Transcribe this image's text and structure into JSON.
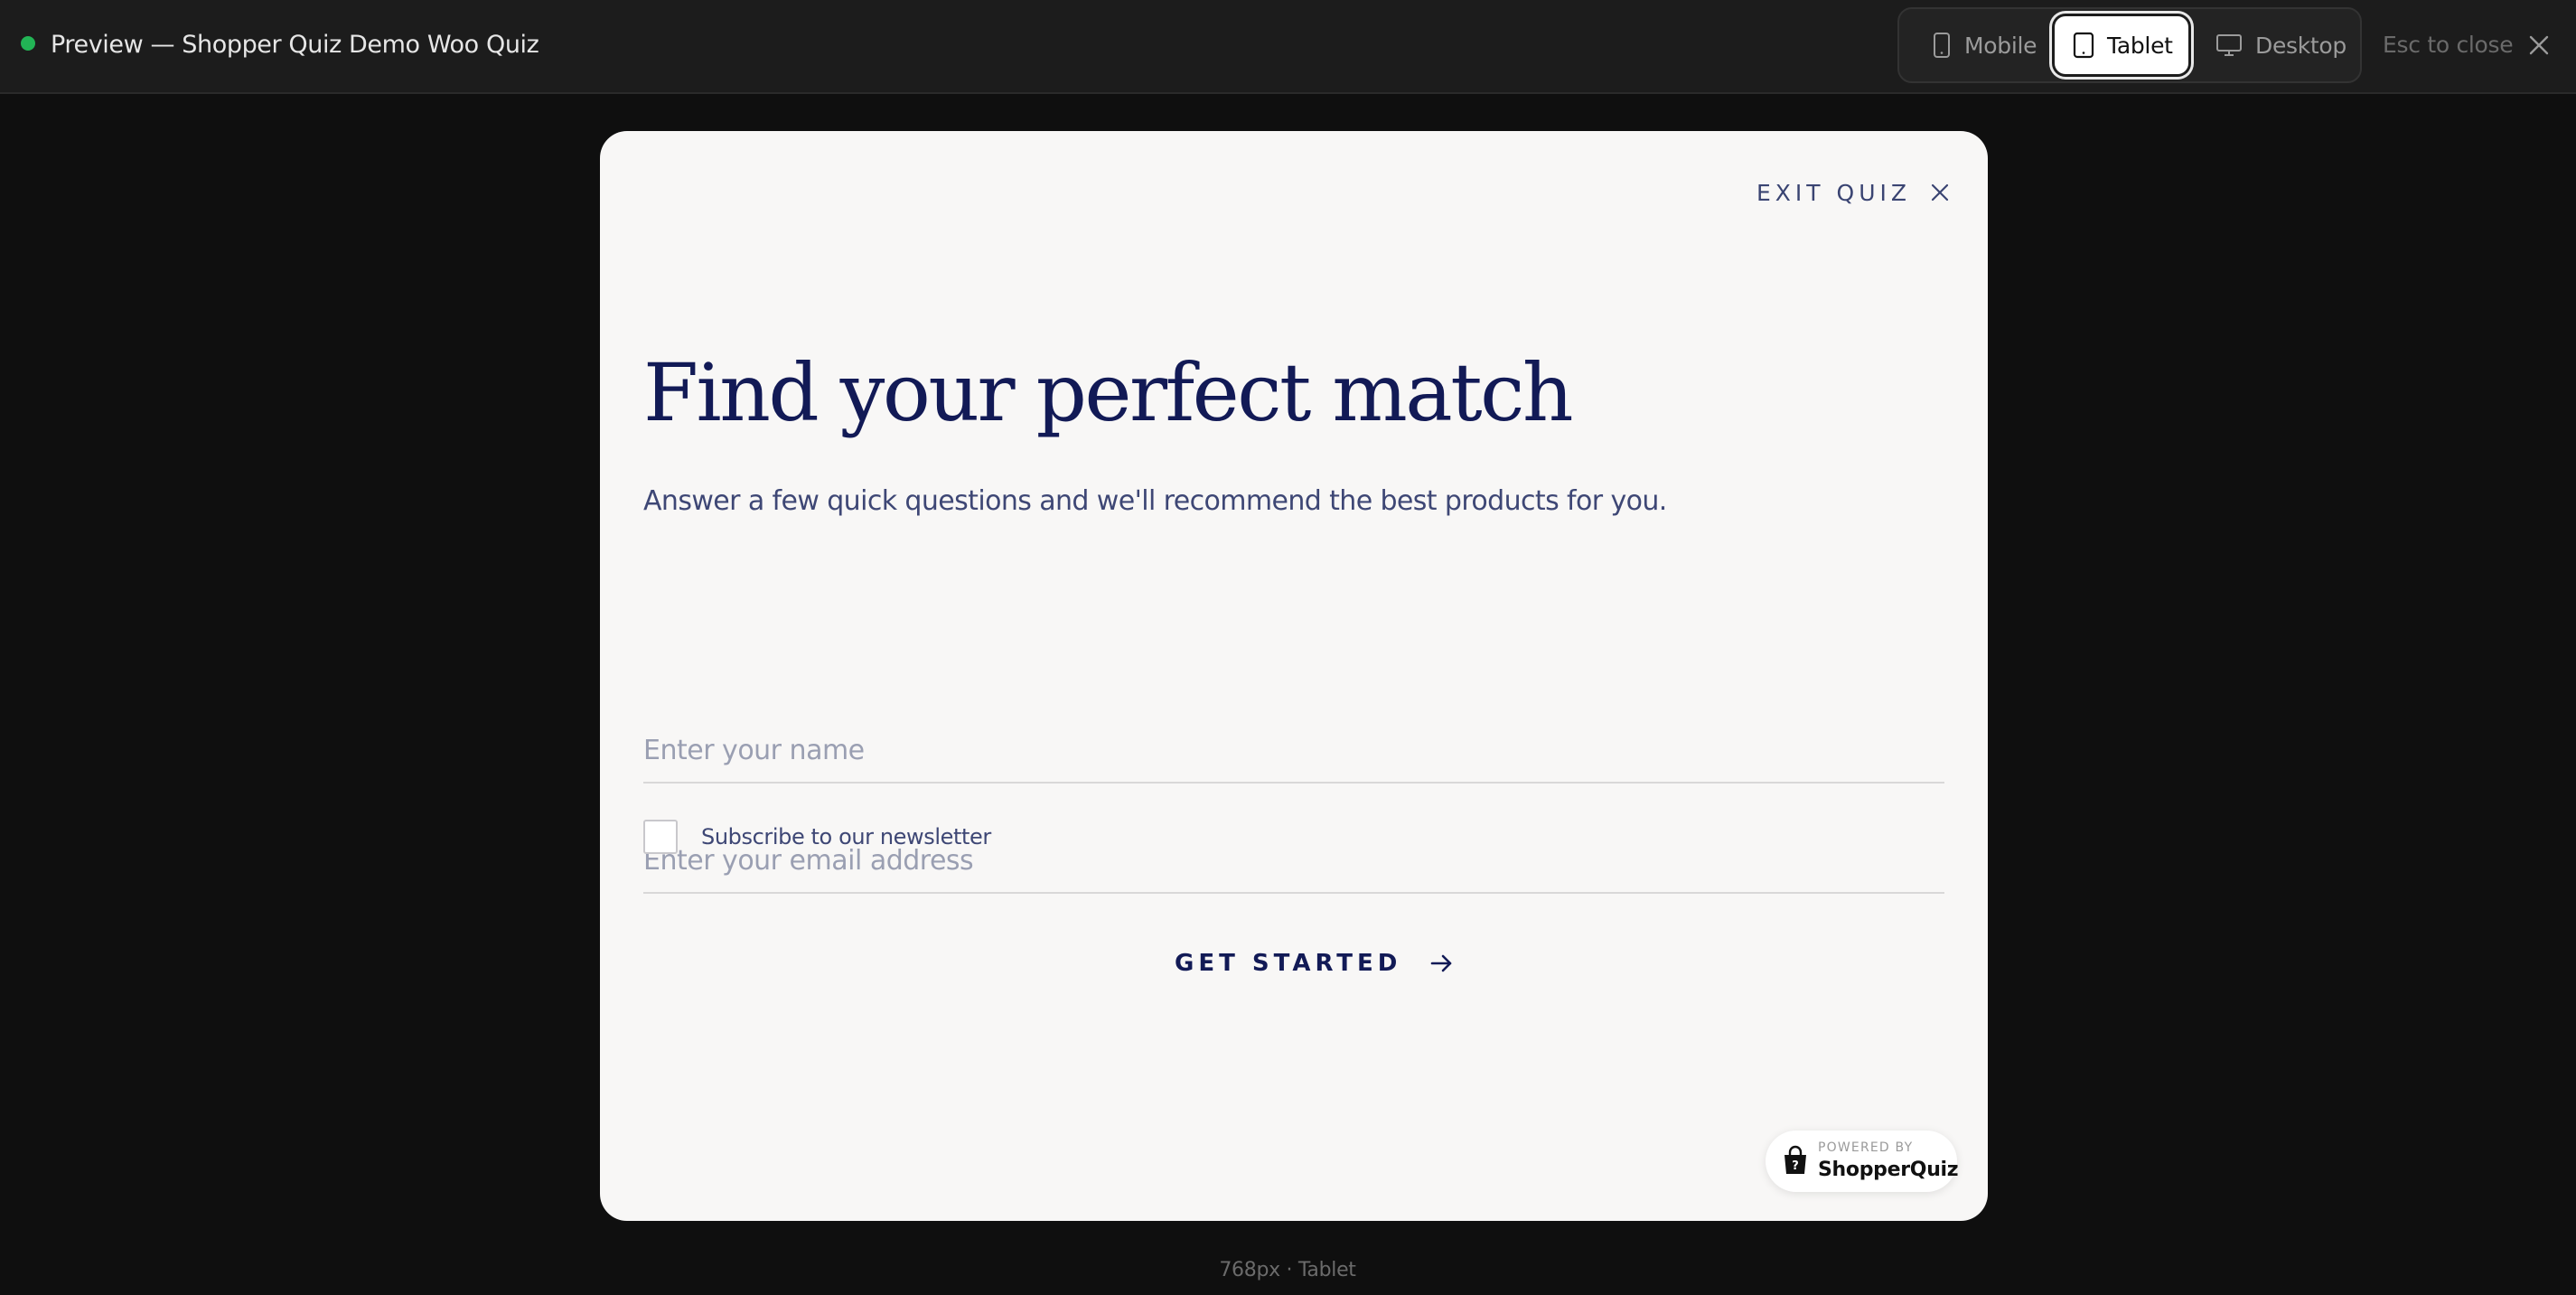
{
  "window": {
    "title": "Preview — Shopper Quiz Demo Woo Quiz",
    "status_color": "#22b455"
  },
  "device_switcher": {
    "selected": "Tablet",
    "options": [
      {
        "label": "Mobile",
        "icon": "phone-icon"
      },
      {
        "label": "Tablet",
        "icon": "tablet-icon"
      },
      {
        "label": "Desktop",
        "icon": "monitor-icon"
      }
    ]
  },
  "esc_hint": "Esc to close",
  "quiz": {
    "exit_label": "EXIT QUIZ",
    "headline": "Find your perfect match",
    "subtitle": "Answer a few quick questions and we'll recommend the best products for you.",
    "name_placeholder": "Enter your name",
    "name_value": "",
    "email_placeholder": "Enter your email address",
    "email_value": "",
    "newsletter_label": "Subscribe to our newsletter",
    "newsletter_checked": false,
    "cta_label": "GET STARTED",
    "colors": {
      "heading": "#121a56",
      "body": "#3e4775",
      "card_background": "#f8f7f6"
    }
  },
  "powered_by": {
    "small_label": "POWERED BY",
    "brand": "ShopperQuiz"
  },
  "viewport_caption": "768px · Tablet"
}
